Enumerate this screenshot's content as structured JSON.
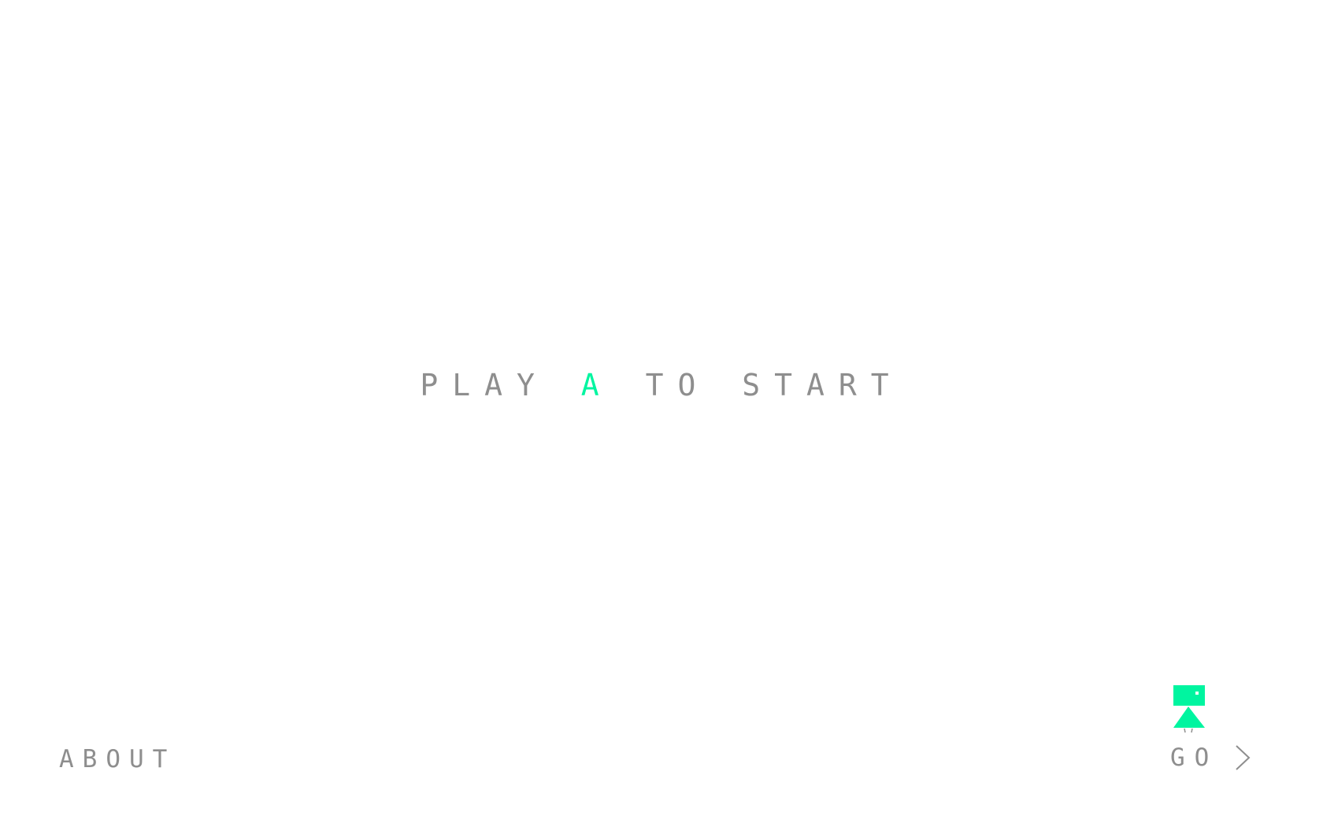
{
  "headline": {
    "before": "PLAY ",
    "accent": "A",
    "after": " TO START"
  },
  "footer": {
    "about_label": "ABOUT",
    "go_label": "GO"
  },
  "icons": {
    "mascot": "robot-mascot-icon",
    "go_arrow": "chevron-right-icon"
  },
  "colors": {
    "accent": "#00f5a0",
    "text": "#8e8e8e",
    "background": "#ffffff"
  }
}
